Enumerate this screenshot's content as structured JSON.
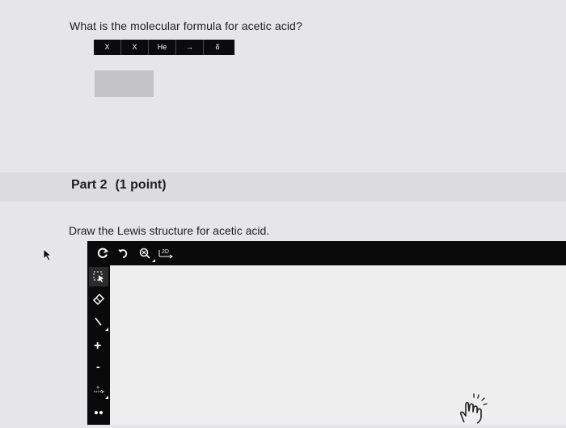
{
  "part1": {
    "question": "What is the molecular formula for acetic acid?",
    "toolbar": [
      "X",
      "X",
      "He",
      "→",
      "δ"
    ],
    "answer_value": ""
  },
  "part2": {
    "part_label": "Part 2",
    "points": "(1 point)",
    "prompt": "Draw the Lewis structure for acetic acid.",
    "top_tools": [
      {
        "icon": "reset-icon"
      },
      {
        "icon": "undo-icon"
      },
      {
        "icon": "zoom-icon"
      },
      {
        "icon": "clean-2d-icon",
        "label": "2D"
      }
    ],
    "side_tools": [
      {
        "icon": "select-icon",
        "selected": true
      },
      {
        "icon": "eraser-icon"
      },
      {
        "icon": "single-bond-icon"
      },
      {
        "icon": "add-charge-icon",
        "label": "+"
      },
      {
        "icon": "remove-charge-icon",
        "label": "-"
      },
      {
        "icon": "radical-arrow-icon"
      },
      {
        "icon": "lone-pair-icon"
      }
    ]
  },
  "colors": {
    "background": "#e6e6e8",
    "toolbar": "#0b0b0b",
    "canvas": "#eeeeef",
    "answer_box": "#c4c4c6"
  }
}
